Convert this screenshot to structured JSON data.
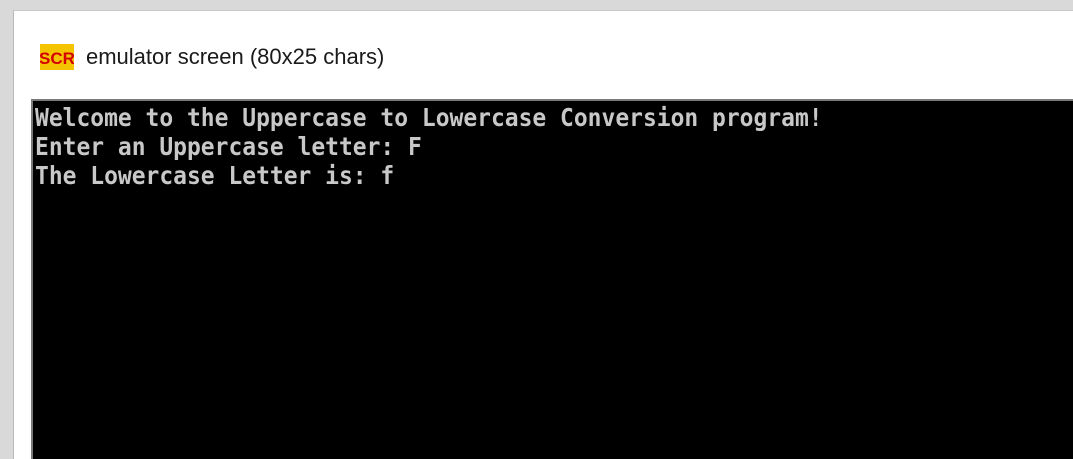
{
  "window": {
    "icon": "scr-app-icon",
    "title": "emulator screen (80x25 chars)"
  },
  "console": {
    "background": "#000000",
    "text_color": "#c8c8c8",
    "lines": [
      "Welcome to the Uppercase to Lowercase Conversion program!",
      "Enter an Uppercase letter: F",
      "The Lowercase Letter is: f"
    ]
  }
}
